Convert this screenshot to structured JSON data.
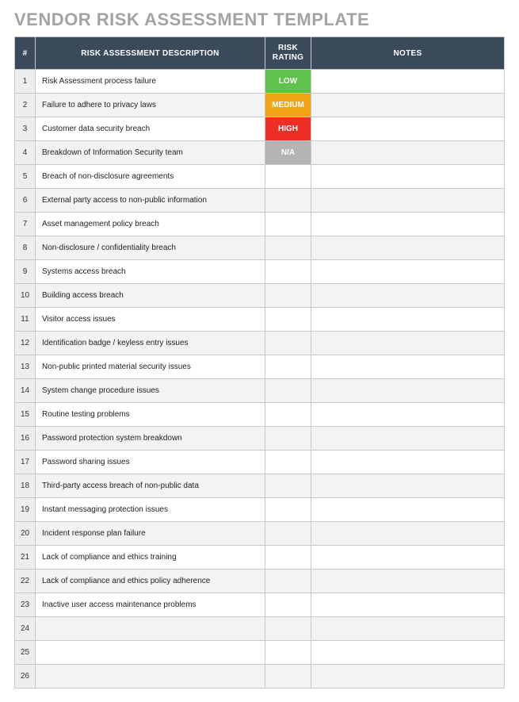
{
  "title": "VENDOR RISK ASSESSMENT TEMPLATE",
  "columns": {
    "num": "#",
    "desc": "RISK ASSESSMENT DESCRIPTION",
    "rating": "RISK RATING",
    "notes": "NOTES"
  },
  "ratings": {
    "low": {
      "label": "LOW",
      "class": "rating-low"
    },
    "medium": {
      "label": "MEDIUM",
      "class": "rating-medium"
    },
    "high": {
      "label": "HIGH",
      "class": "rating-high"
    },
    "na": {
      "label": "N/A",
      "class": "rating-na"
    }
  },
  "rows": [
    {
      "num": "1",
      "desc": "Risk Assessment process failure",
      "rating": "low",
      "notes": ""
    },
    {
      "num": "2",
      "desc": "Failure to adhere to privacy laws",
      "rating": "medium",
      "notes": ""
    },
    {
      "num": "3",
      "desc": "Customer data security breach",
      "rating": "high",
      "notes": ""
    },
    {
      "num": "4",
      "desc": "Breakdown of Information Security team",
      "rating": "na",
      "notes": ""
    },
    {
      "num": "5",
      "desc": "Breach of non-disclosure agreements",
      "rating": "",
      "notes": ""
    },
    {
      "num": "6",
      "desc": "External party access to non-public information",
      "rating": "",
      "notes": ""
    },
    {
      "num": "7",
      "desc": "Asset management policy breach",
      "rating": "",
      "notes": ""
    },
    {
      "num": "8",
      "desc": "Non-disclosure / confidentiality breach",
      "rating": "",
      "notes": ""
    },
    {
      "num": "9",
      "desc": "Systems access breach",
      "rating": "",
      "notes": ""
    },
    {
      "num": "10",
      "desc": "Building access breach",
      "rating": "",
      "notes": ""
    },
    {
      "num": "11",
      "desc": "Visitor access issues",
      "rating": "",
      "notes": ""
    },
    {
      "num": "12",
      "desc": "Identification badge / keyless entry issues",
      "rating": "",
      "notes": ""
    },
    {
      "num": "13",
      "desc": "Non-public printed material security issues",
      "rating": "",
      "notes": ""
    },
    {
      "num": "14",
      "desc": "System change procedure issues",
      "rating": "",
      "notes": ""
    },
    {
      "num": "15",
      "desc": "Routine testing problems",
      "rating": "",
      "notes": ""
    },
    {
      "num": "16",
      "desc": "Password protection system breakdown",
      "rating": "",
      "notes": ""
    },
    {
      "num": "17",
      "desc": "Password sharing issues",
      "rating": "",
      "notes": ""
    },
    {
      "num": "18",
      "desc": "Third-party access breach of non-public data",
      "rating": "",
      "notes": ""
    },
    {
      "num": "19",
      "desc": "Instant messaging protection issues",
      "rating": "",
      "notes": ""
    },
    {
      "num": "20",
      "desc": "Incident response plan failure",
      "rating": "",
      "notes": ""
    },
    {
      "num": "21",
      "desc": "Lack of compliance and ethics training",
      "rating": "",
      "notes": ""
    },
    {
      "num": "22",
      "desc": "Lack of compliance and ethics policy adherence",
      "rating": "",
      "notes": ""
    },
    {
      "num": "23",
      "desc": "Inactive user access maintenance problems",
      "rating": "",
      "notes": ""
    },
    {
      "num": "24",
      "desc": "",
      "rating": "",
      "notes": ""
    },
    {
      "num": "25",
      "desc": "",
      "rating": "",
      "notes": ""
    },
    {
      "num": "26",
      "desc": "",
      "rating": "",
      "notes": ""
    }
  ]
}
